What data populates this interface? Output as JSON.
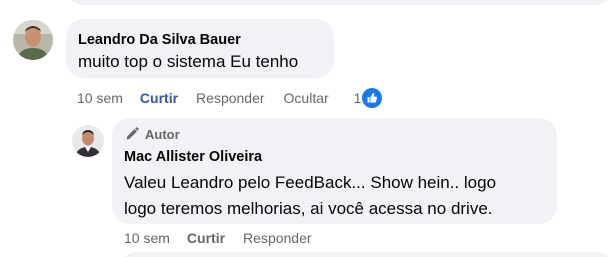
{
  "comments": [
    {
      "author": "Leandro Da Silva Bauer",
      "text": "muito top o sistema Eu tenho",
      "actions": {
        "time": "10 sem",
        "like": "Curtir",
        "reply": "Responder",
        "hide": "Ocultar",
        "reaction_count": "1"
      }
    }
  ],
  "reply": {
    "badge": "Autor",
    "author": "Mac Allister Oliveira",
    "text_line1": "Valeu Leandro pelo FeedBack... Show hein.. logo",
    "text_line2": "logo teremos melhorias, ai você acessa no drive.",
    "actions": {
      "time": "10 sem",
      "like": "Curtir",
      "reply": "Responder"
    }
  },
  "colors": {
    "bubble": "#f0f2f5",
    "text": "#050505",
    "secondary": "#65676b",
    "link": "#385898",
    "like_blue": "#1877f2"
  },
  "icons": [
    "pencil-icon",
    "like-reaction-icon"
  ]
}
